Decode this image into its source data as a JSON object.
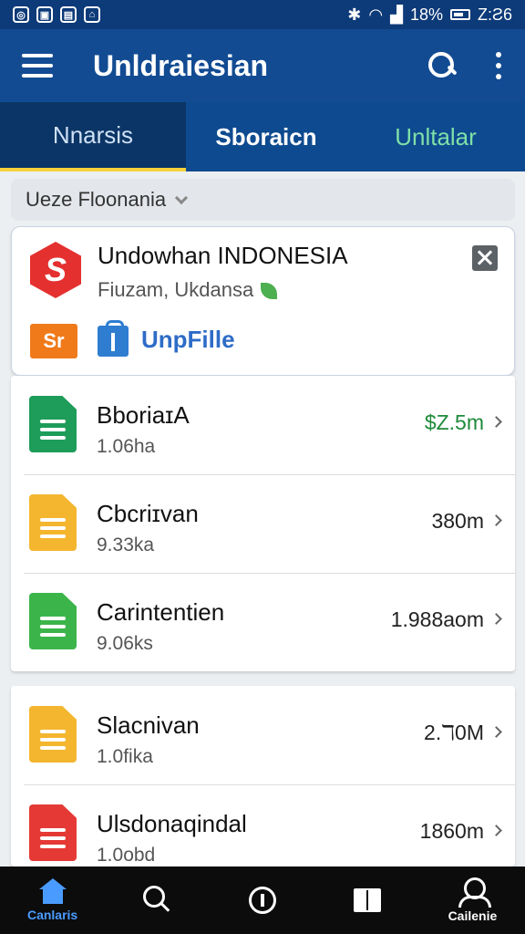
{
  "status_bar": {
    "battery": "18%",
    "time": "Z:Ƨ6"
  },
  "app_bar": {
    "title": "Unldraiesian"
  },
  "tabs": [
    {
      "label": "Nnarsis"
    },
    {
      "label": "Sboraicn"
    },
    {
      "label": "Unltalar"
    }
  ],
  "filter": {
    "label": "Ueze Floonania"
  },
  "featured": {
    "logo_letter": "S",
    "title": "Undowhan INDONESIA",
    "subtitle": "Fiuzam, Ukdansa",
    "badge": "Sr",
    "link_label": "UnpFille"
  },
  "list_group_1": [
    {
      "name": "BboriaɪA",
      "sub": "1.06ha",
      "value": "$Z.5m",
      "icon_color": "#1e9c5a",
      "value_color": "green"
    },
    {
      "name": "Cbcriɪvan",
      "sub": "9.33ka",
      "value": "380m",
      "icon_color": "#f4b62f",
      "value_color": "default"
    },
    {
      "name": "Carintentien",
      "sub": "9.06ks",
      "value": "1.988aom",
      "icon_color": "#3bb54a",
      "value_color": "default"
    }
  ],
  "list_group_2": [
    {
      "name": "Slacnivan",
      "sub": "1.0fika",
      "value": "2.ℸ0M",
      "icon_color": "#f4b62f",
      "value_color": "default"
    },
    {
      "name": "Ulsdonaqindal",
      "sub": "1.0obd",
      "value": "1860m",
      "icon_color": "#e53935",
      "value_color": "default"
    }
  ],
  "bottom_nav": [
    {
      "label": "Canlaris",
      "icon": "home-icon",
      "active": true
    },
    {
      "label": "",
      "icon": "search-icon",
      "active": false
    },
    {
      "label": "",
      "icon": "info-icon",
      "active": false
    },
    {
      "label": "",
      "icon": "book-icon",
      "active": false
    },
    {
      "label": "Cailenie",
      "icon": "profile-icon",
      "active": false
    }
  ],
  "colors": {
    "appbar": "#124b92",
    "tab_indicator": "#f5d23c",
    "accent_green": "#1e8a3a",
    "nav_active": "#4a9bff"
  }
}
